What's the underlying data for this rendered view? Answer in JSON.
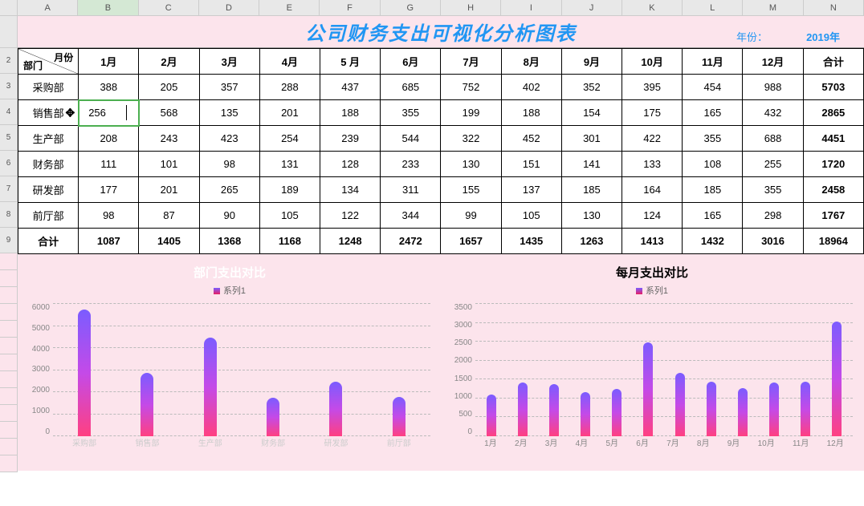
{
  "columns": [
    "A",
    "B",
    "C",
    "D",
    "E",
    "F",
    "G",
    "H",
    "I",
    "J",
    "K",
    "L",
    "M",
    "N"
  ],
  "selected_col": "B",
  "title": "公司财务支出可视化分析图表",
  "year_label": "年份：",
  "year_value": "2019年",
  "header_diag_top": "月份",
  "header_diag_bottom": "部门",
  "months": [
    "1月",
    "2月",
    "3月",
    "4月",
    "5 月",
    "6月",
    "7月",
    "8月",
    "9月",
    "10月",
    "11月",
    "12月"
  ],
  "total_col_label": "合计",
  "total_row_label": "合计",
  "editing_cell": {
    "row_idx": 1,
    "col_idx": 0,
    "value": "256"
  },
  "rows": [
    {
      "dept": "采购部",
      "vals": [
        388,
        205,
        357,
        288,
        437,
        685,
        752,
        402,
        352,
        395,
        454,
        988
      ],
      "total": 5703
    },
    {
      "dept": "销售部",
      "vals": [
        256,
        568,
        135,
        201,
        188,
        355,
        199,
        188,
        154,
        175,
        165,
        432
      ],
      "total": 2865
    },
    {
      "dept": "生产部",
      "vals": [
        208,
        243,
        423,
        254,
        239,
        544,
        322,
        452,
        301,
        422,
        355,
        688
      ],
      "total": 4451
    },
    {
      "dept": "财务部",
      "vals": [
        111,
        101,
        98,
        131,
        128,
        233,
        130,
        151,
        141,
        133,
        108,
        255
      ],
      "total": 1720
    },
    {
      "dept": "研发部",
      "vals": [
        177,
        201,
        265,
        189,
        134,
        311,
        155,
        137,
        185,
        164,
        185,
        355
      ],
      "total": 2458
    },
    {
      "dept": "前厅部",
      "vals": [
        98,
        87,
        90,
        105,
        122,
        344,
        99,
        105,
        130,
        124,
        165,
        298
      ],
      "total": 1767
    }
  ],
  "totals": [
    1087,
    1405,
    1368,
    1168,
    1248,
    2472,
    1657,
    1435,
    1263,
    1413,
    1432,
    3016
  ],
  "grand_total": 18964,
  "chart_data": [
    {
      "type": "bar",
      "title": "部门支出对比",
      "legend": "系列1",
      "categories": [
        "采购部",
        "销售部",
        "生产部",
        "财务部",
        "研发部",
        "前厅部"
      ],
      "values": [
        5703,
        2865,
        4451,
        1720,
        2458,
        1767
      ],
      "ylim": [
        0,
        6000
      ],
      "ystep": 1000,
      "xlabel": "",
      "ylabel": ""
    },
    {
      "type": "bar",
      "title": "每月支出对比",
      "legend": "系列1",
      "categories": [
        "1月",
        "2月",
        "3月",
        "4月",
        "5月",
        "6月",
        "7月",
        "8月",
        "9月",
        "10月",
        "11月",
        "12月"
      ],
      "values": [
        1087,
        1405,
        1368,
        1168,
        1248,
        2472,
        1657,
        1435,
        1263,
        1413,
        1432,
        3016
      ],
      "ylim": [
        0,
        3500
      ],
      "ystep": 500,
      "xlabel": "",
      "ylabel": ""
    }
  ]
}
